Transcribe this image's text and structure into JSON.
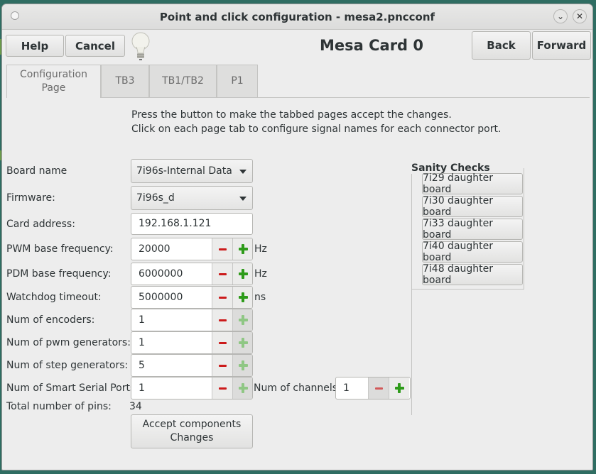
{
  "window": {
    "title": "Point and click configuration - mesa2.pncconf"
  },
  "toolbar": {
    "help_label": "Help",
    "cancel_label": "Cancel",
    "header_title": "Mesa Card 0",
    "back_label": "Back",
    "forward_label": "Forward"
  },
  "tabs": [
    {
      "label_line1": "Configuration",
      "label_line2": "Page"
    },
    {
      "label": "TB3"
    },
    {
      "label": "TB1/TB2"
    },
    {
      "label": "P1"
    }
  ],
  "info": {
    "line1": "Press the button to make the tabbed pages accept the changes.",
    "line2": "Click on each page tab to configure signal names for each connector port."
  },
  "form": {
    "board_name": {
      "label": "Board name",
      "value": "7i96s-Internal Data"
    },
    "firmware": {
      "label": "Firmware:",
      "value": "7i96s_d"
    },
    "card_address": {
      "label": "Card address:",
      "value": "192.168.1.121"
    },
    "pwm_freq": {
      "label": "PWM base frequency:",
      "value": "20000",
      "unit": "Hz"
    },
    "pdm_freq": {
      "label": "PDM base frequency:",
      "value": "6000000",
      "unit": "Hz"
    },
    "watchdog": {
      "label": "Watchdog timeout:",
      "value": "5000000",
      "unit": "ns"
    },
    "encoders": {
      "label": "Num of encoders:",
      "value": "1"
    },
    "pwm_gens": {
      "label": "Num of pwm generators:",
      "value": "1"
    },
    "step_gens": {
      "label": "Num of step generators:",
      "value": "5"
    },
    "sserial": {
      "label": "Num of Smart Serial Ports:",
      "value": "1"
    },
    "channels": {
      "label": "Num of channels:",
      "value": "1"
    },
    "total_pins": {
      "label": "Total number of pins:",
      "value": "34"
    },
    "accept_line1": "Accept  components",
    "accept_line2": "Changes"
  },
  "sanity": {
    "title": "Sanity Checks",
    "buttons": [
      "7i29 daughter board",
      "7i30 daughter board",
      "7i33 daughter board",
      "7i40 daughter board",
      "7i48 daughter board"
    ]
  },
  "colors": {
    "minus_icon": "#cc1b1b",
    "plus_icon": "#2e9b1a",
    "desktop": "#2f6d62"
  }
}
